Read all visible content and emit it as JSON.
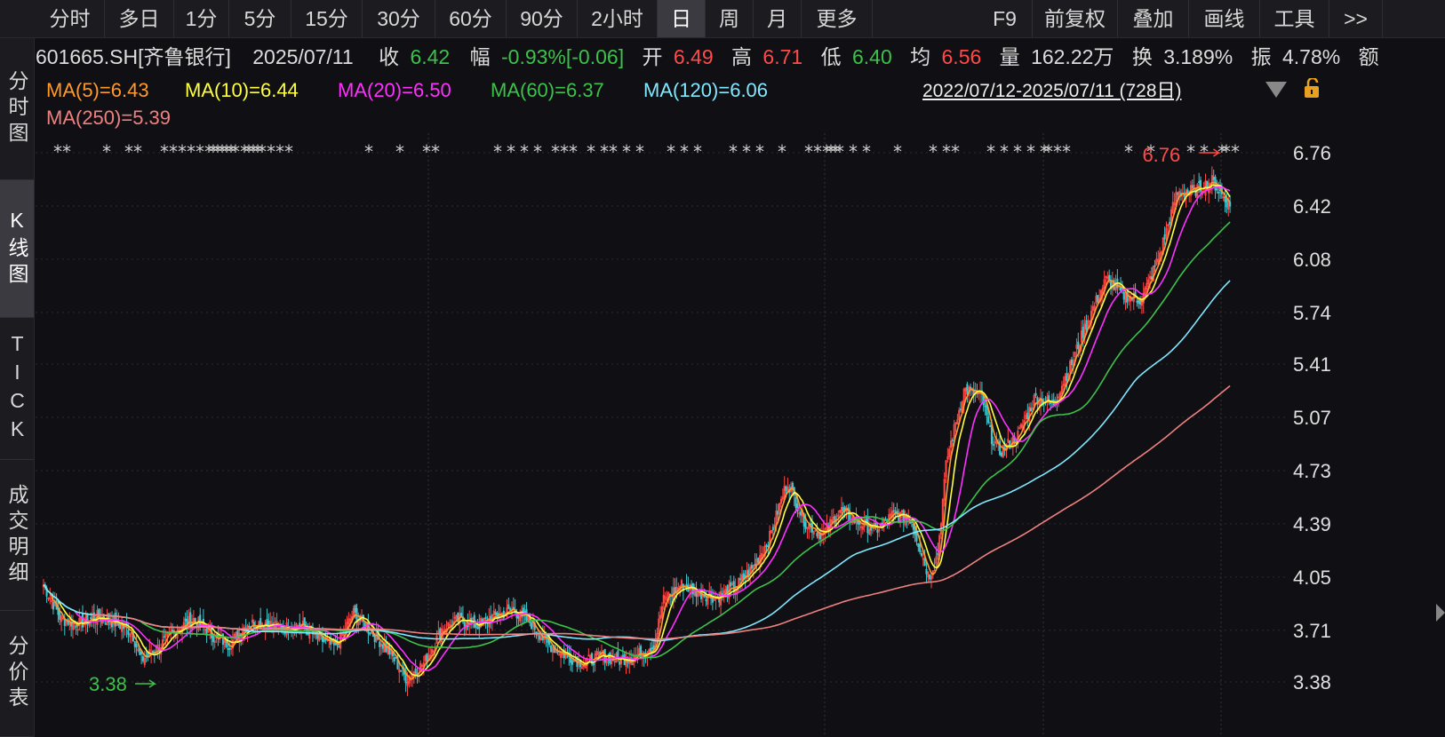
{
  "toolbar": {
    "tabs": [
      {
        "label": "分时"
      },
      {
        "label": "多日"
      },
      {
        "label": "1分"
      },
      {
        "label": "5分"
      },
      {
        "label": "15分"
      },
      {
        "label": "30分"
      },
      {
        "label": "60分"
      },
      {
        "label": "90分"
      },
      {
        "label": "2小时"
      },
      {
        "label": "日",
        "active": true
      },
      {
        "label": "周"
      },
      {
        "label": "月"
      },
      {
        "label": "更多"
      }
    ],
    "right": [
      {
        "label": "F9"
      },
      {
        "label": "前复权"
      },
      {
        "label": "叠加"
      },
      {
        "label": "画线"
      },
      {
        "label": "工具"
      },
      {
        "label": ">>"
      }
    ]
  },
  "sidebar": [
    {
      "label": "分时图"
    },
    {
      "label": "K线图",
      "active": true
    },
    {
      "label": "TICK"
    },
    {
      "label": "成交明细"
    },
    {
      "label": "分价表"
    }
  ],
  "quote": {
    "symbol": "601665.SH[齐鲁银行]",
    "date": "2025/07/11",
    "close_label": "收",
    "close": "6.42",
    "change_label": "幅",
    "change": "-0.93%[-0.06]",
    "open_label": "开",
    "open": "6.49",
    "high_label": "高",
    "high": "6.71",
    "low_label": "低",
    "low": "6.40",
    "avg_label": "均",
    "avg": "6.56",
    "vol_label": "量",
    "vol": "162.22万",
    "turnover_label": "换",
    "turnover": "3.189%",
    "amp_label": "振",
    "amp": "4.78%",
    "more_label": "额"
  },
  "ma": {
    "ma5": "MA(5)=6.43",
    "ma10": "MA(10)=6.44",
    "ma20": "MA(20)=6.50",
    "ma60": "MA(60)=6.37",
    "ma120": "MA(120)=6.06",
    "ma250": "MA(250)=5.39"
  },
  "date_range": "2022/07/12-2025/07/11 (728日)",
  "colors": {
    "up": "#ff4a4a",
    "down": "#3ec8d0",
    "ma5": "#ff9a2a",
    "ma10": "#ffff40",
    "ma20": "#ff30ff",
    "ma60": "#3cc24a",
    "ma120": "#80e8ff",
    "ma250": "#f08080",
    "annotation_high": "#ff4a4a",
    "annotation_low": "#3cc24a"
  },
  "chart_data": {
    "type": "candlestick",
    "period": "daily",
    "y_ticks": [
      6.76,
      6.42,
      6.08,
      5.74,
      5.41,
      5.07,
      4.73,
      4.39,
      4.05,
      3.71,
      3.38
    ],
    "ylim": [
      3.38,
      6.76
    ],
    "annotations": {
      "high": "6.76",
      "low": "3.38"
    },
    "approx_close_path": [
      [
        0,
        4.0
      ],
      [
        20,
        3.78
      ],
      [
        40,
        3.75
      ],
      [
        60,
        3.8
      ],
      [
        80,
        3.76
      ],
      [
        100,
        3.7
      ],
      [
        110,
        3.52
      ],
      [
        130,
        3.6
      ],
      [
        150,
        3.72
      ],
      [
        170,
        3.78
      ],
      [
        190,
        3.68
      ],
      [
        210,
        3.62
      ],
      [
        230,
        3.75
      ],
      [
        250,
        3.76
      ],
      [
        270,
        3.72
      ],
      [
        290,
        3.75
      ],
      [
        310,
        3.66
      ],
      [
        330,
        3.6
      ],
      [
        350,
        3.82
      ],
      [
        370,
        3.7
      ],
      [
        390,
        3.58
      ],
      [
        410,
        3.4
      ],
      [
        430,
        3.5
      ],
      [
        450,
        3.72
      ],
      [
        470,
        3.78
      ],
      [
        490,
        3.74
      ],
      [
        510,
        3.8
      ],
      [
        530,
        3.84
      ],
      [
        550,
        3.76
      ],
      [
        570,
        3.62
      ],
      [
        590,
        3.55
      ],
      [
        610,
        3.5
      ],
      [
        630,
        3.55
      ],
      [
        650,
        3.52
      ],
      [
        670,
        3.55
      ],
      [
        690,
        3.62
      ],
      [
        700,
        3.9
      ],
      [
        720,
        4.0
      ],
      [
        740,
        3.95
      ],
      [
        760,
        3.92
      ],
      [
        780,
        3.98
      ],
      [
        800,
        4.1
      ],
      [
        820,
        4.3
      ],
      [
        840,
        4.66
      ],
      [
        860,
        4.4
      ],
      [
        880,
        4.32
      ],
      [
        900,
        4.48
      ],
      [
        920,
        4.4
      ],
      [
        940,
        4.35
      ],
      [
        960,
        4.45
      ],
      [
        980,
        4.42
      ],
      [
        1000,
        4.05
      ],
      [
        1010,
        4.2
      ],
      [
        1020,
        4.8
      ],
      [
        1040,
        5.25
      ],
      [
        1060,
        5.2
      ],
      [
        1070,
        4.95
      ],
      [
        1080,
        4.85
      ],
      [
        1100,
        4.95
      ],
      [
        1120,
        5.2
      ],
      [
        1140,
        5.15
      ],
      [
        1160,
        5.4
      ],
      [
        1180,
        5.7
      ],
      [
        1200,
        5.95
      ],
      [
        1220,
        5.85
      ],
      [
        1240,
        5.82
      ],
      [
        1260,
        6.1
      ],
      [
        1280,
        6.5
      ],
      [
        1300,
        6.52
      ],
      [
        1320,
        6.58
      ],
      [
        1340,
        6.42
      ]
    ]
  }
}
